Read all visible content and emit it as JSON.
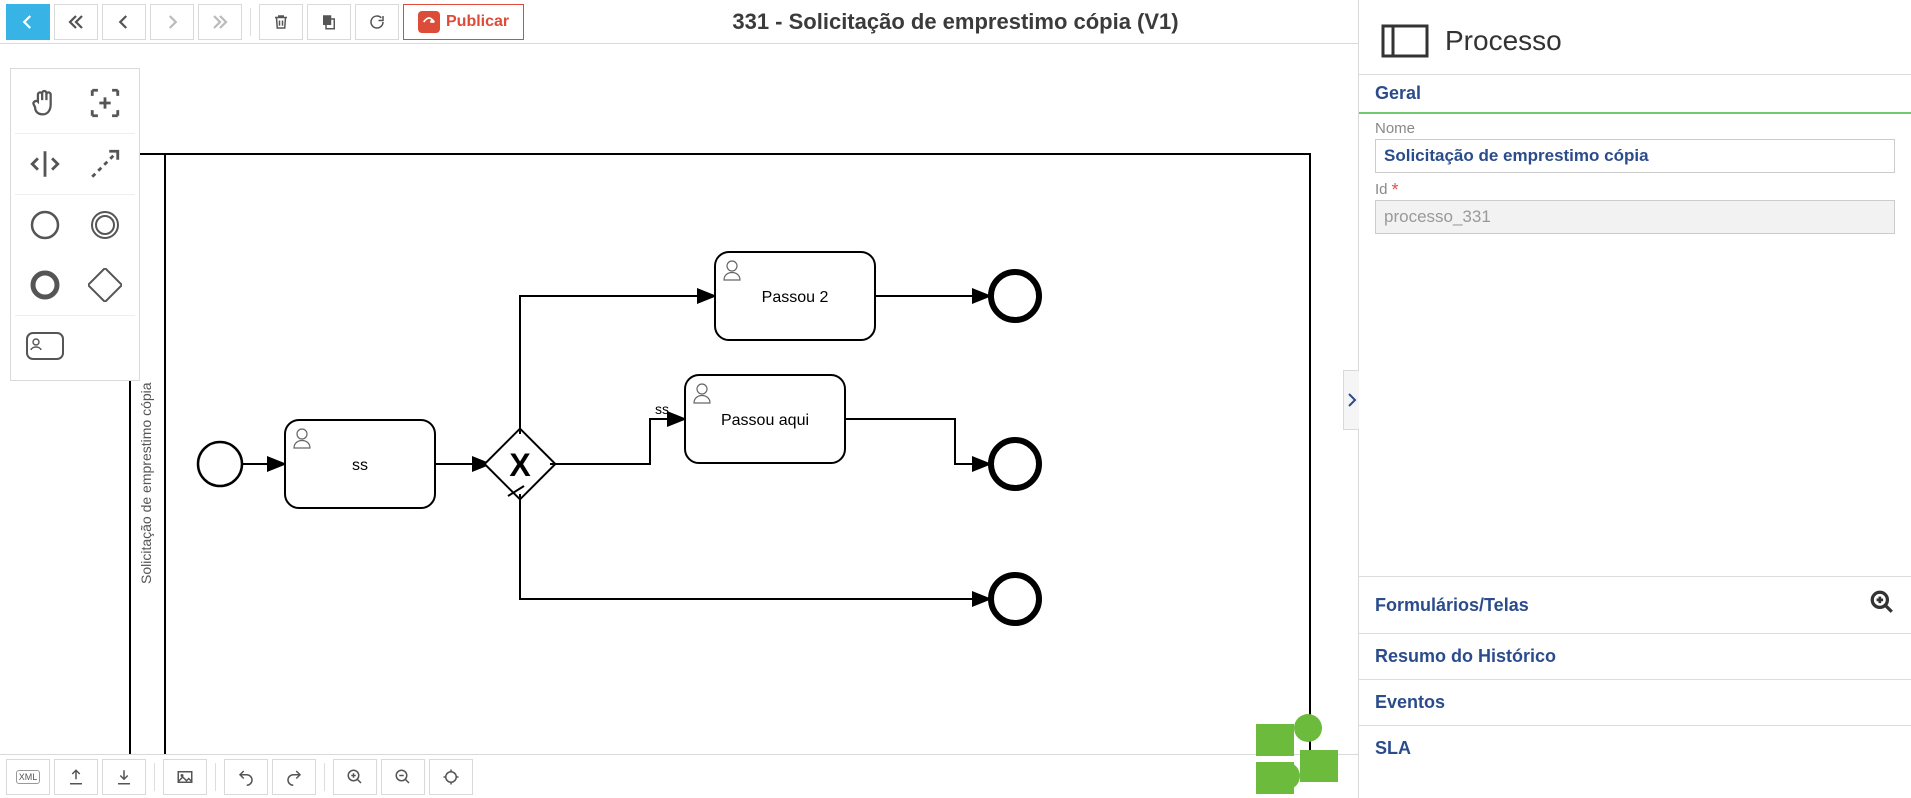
{
  "toolbar": {
    "publish_label": "Publicar"
  },
  "page": {
    "title": "331 - Solicitação de emprestimo cópia (V1)"
  },
  "diagram": {
    "pool_label": "Solicitação de emprestimo cópia",
    "task_ss": "ss",
    "edge_ss": "ss",
    "task_passou2": "Passou 2",
    "task_passou_aqui": "Passou aqui"
  },
  "panel": {
    "header": "Processo",
    "section_general": "Geral",
    "nome_label": "Nome",
    "nome_value": "Solicitação de emprestimo cópia",
    "id_label": "Id",
    "id_value": "processo_331",
    "acc_forms": "Formulários/Telas",
    "acc_history": "Resumo do Histórico",
    "acc_events": "Eventos",
    "acc_sla": "SLA"
  }
}
